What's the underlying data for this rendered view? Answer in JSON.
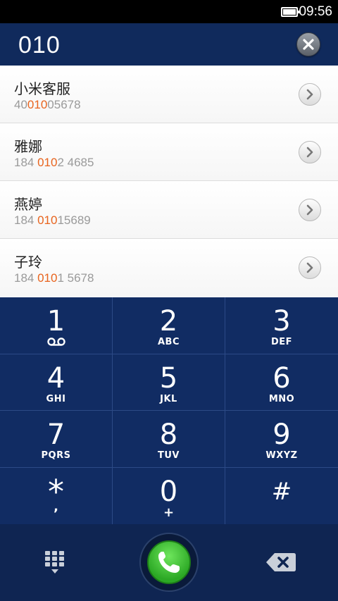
{
  "status": {
    "time": "09:56"
  },
  "dialer": {
    "input": "010"
  },
  "results": [
    {
      "name": "小米客服",
      "num_pre": "40",
      "num_hl": "010",
      "num_post": "05678"
    },
    {
      "name": "雅娜",
      "num_pre": "184 ",
      "num_hl": "010",
      "num_post": "2 4685"
    },
    {
      "name": "燕婷",
      "num_pre": "184 ",
      "num_hl": "010",
      "num_post": "15689"
    },
    {
      "name": "子玲",
      "num_pre": "184 ",
      "num_hl": "010",
      "num_post": "1 5678"
    }
  ],
  "keypad": {
    "k1": {
      "digit": "1"
    },
    "k2": {
      "digit": "2",
      "letters": "ABC"
    },
    "k3": {
      "digit": "3",
      "letters": "DEF"
    },
    "k4": {
      "digit": "4",
      "letters": "GHI"
    },
    "k5": {
      "digit": "5",
      "letters": "JKL"
    },
    "k6": {
      "digit": "6",
      "letters": "MNO"
    },
    "k7": {
      "digit": "7",
      "letters": "PQRS"
    },
    "k8": {
      "digit": "8",
      "letters": "TUV"
    },
    "k9": {
      "digit": "9",
      "letters": "WXYZ"
    },
    "kstar": {
      "digit": "*",
      "sub": ","
    },
    "k0": {
      "digit": "0",
      "sub": "+"
    },
    "khash": {
      "digit": "#"
    }
  },
  "icons": {
    "clear": "close-icon",
    "detail": "chevron-right-icon",
    "voicemail": "voicemail-icon",
    "keypad_toggle": "dialpad-icon",
    "call": "phone-icon",
    "backspace": "backspace-icon"
  },
  "colors": {
    "highlight": "#e8641e",
    "call_green": "#3cc633",
    "keypad_bg": "#112c63"
  }
}
